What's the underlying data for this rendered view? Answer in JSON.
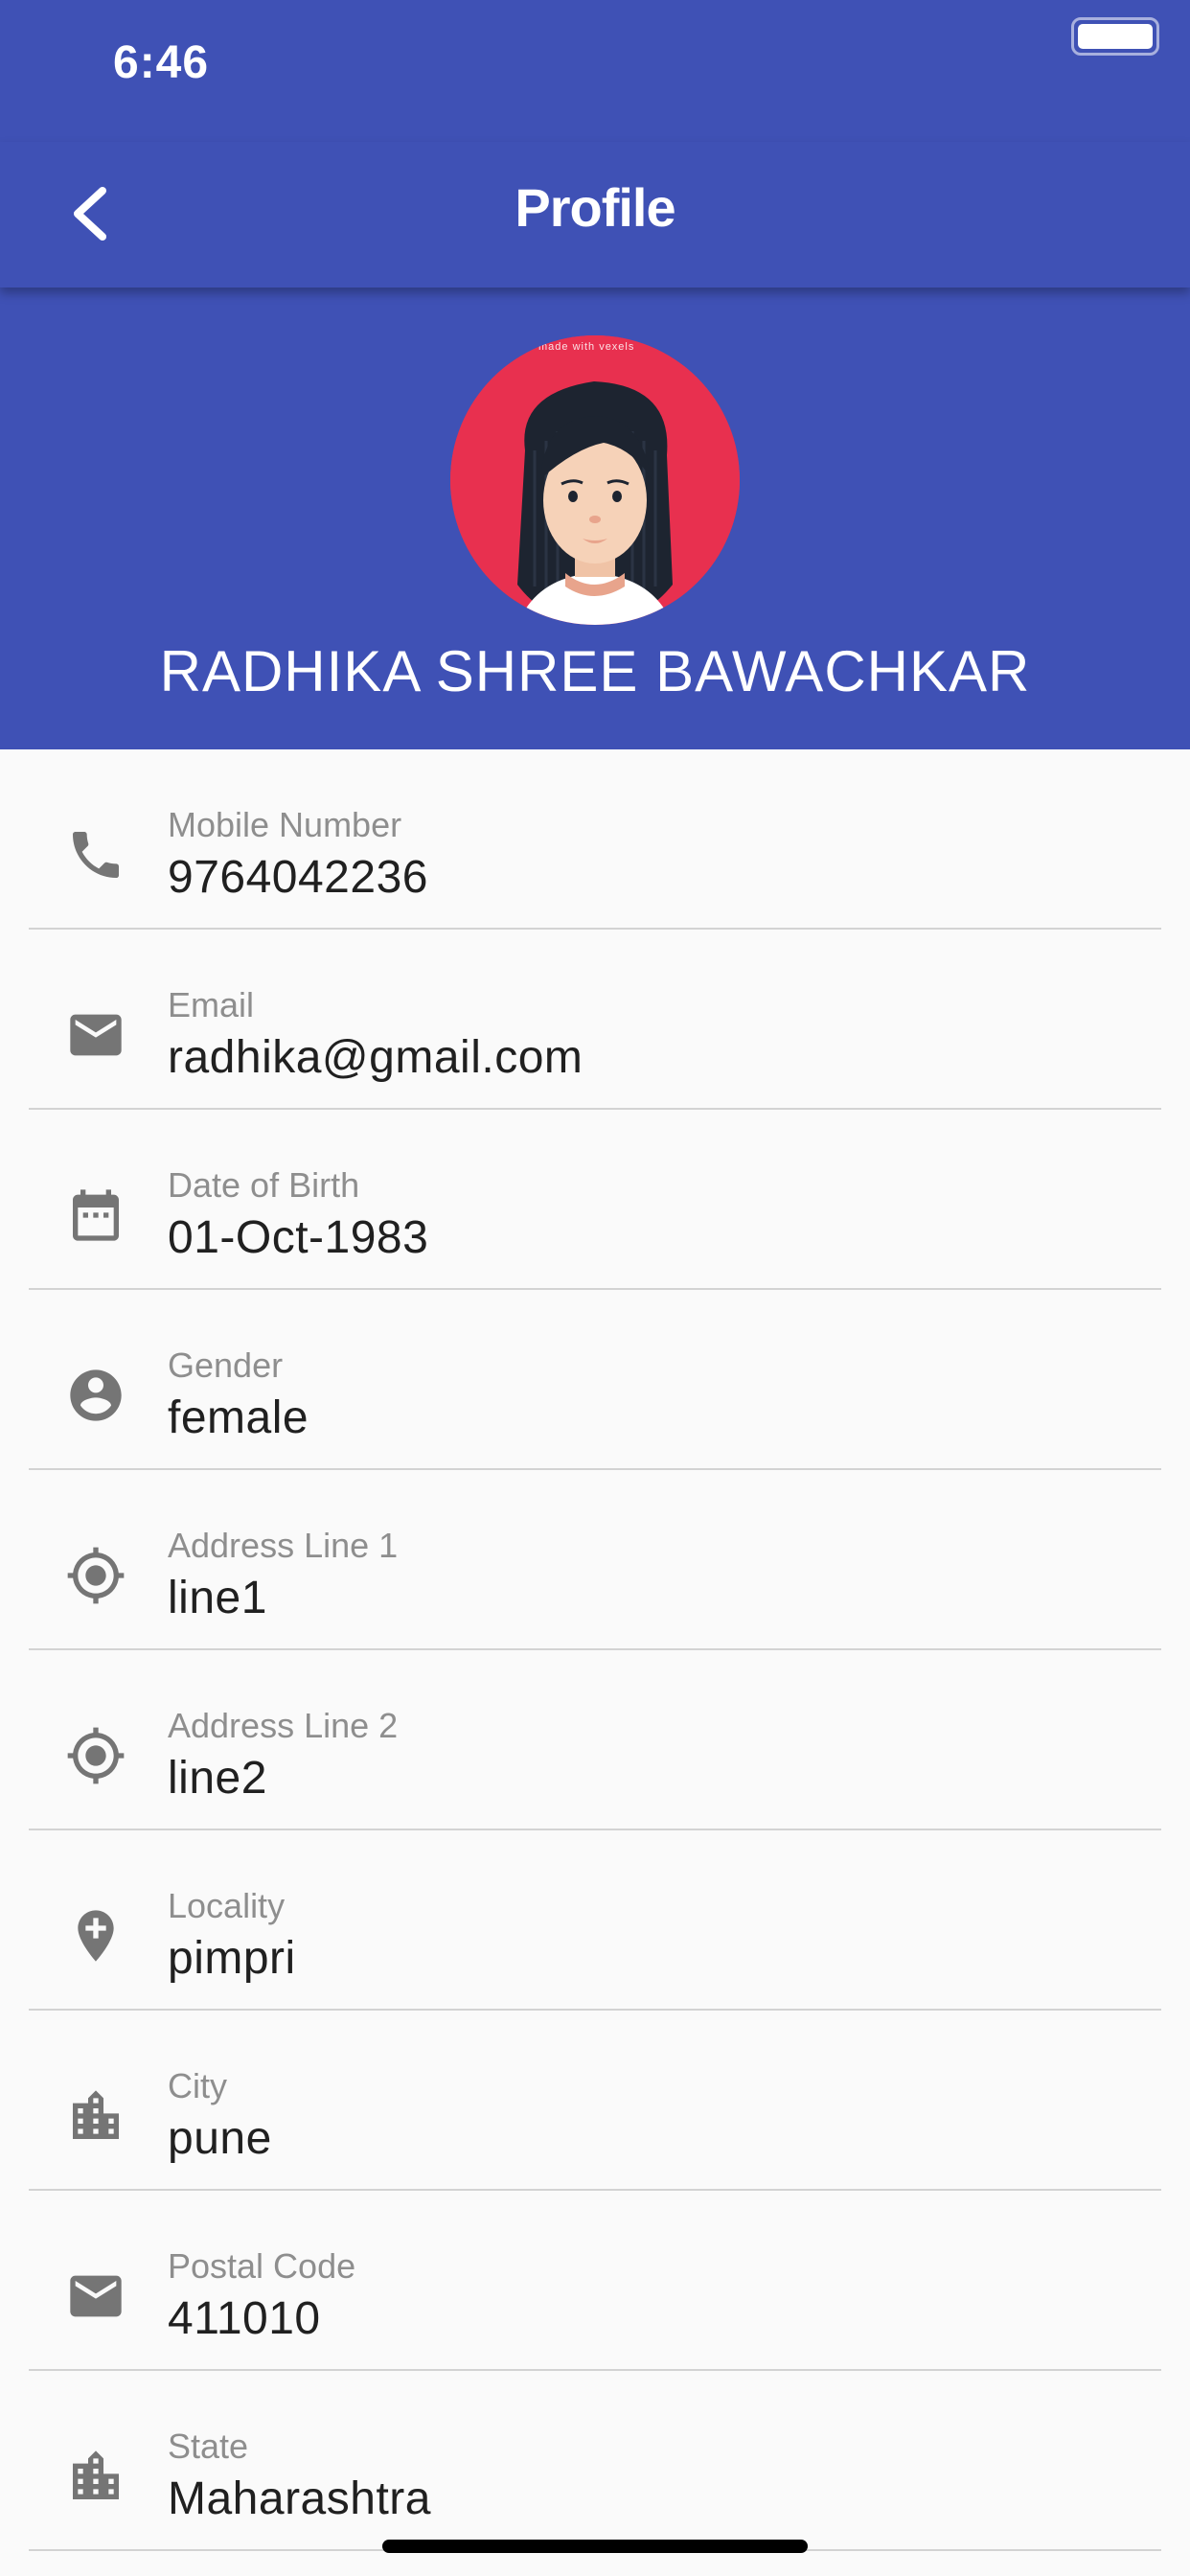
{
  "status_bar": {
    "time": "6:46"
  },
  "app_bar": {
    "title": "Profile",
    "back_icon": "chevron-left-icon"
  },
  "header": {
    "name": "RADHIKA SHREE BAWACHKAR",
    "avatar_watermark": "made with vexels",
    "background_color": "#3f51b5",
    "avatar_background": "#e8304f"
  },
  "fields": [
    {
      "icon": "phone-icon",
      "label": "Mobile Number",
      "value": "9764042236"
    },
    {
      "icon": "mail-icon",
      "label": "Email",
      "value": "radhika@gmail.com"
    },
    {
      "icon": "calendar-icon",
      "label": "Date of Birth",
      "value": "01-Oct-1983"
    },
    {
      "icon": "account-circle-icon",
      "label": "Gender",
      "value": "female"
    },
    {
      "icon": "gps-target-icon",
      "label": "Address Line 1",
      "value": "line1"
    },
    {
      "icon": "gps-target-icon",
      "label": "Address Line 2",
      "value": "line2"
    },
    {
      "icon": "add-location-icon",
      "label": "Locality",
      "value": "pimpri"
    },
    {
      "icon": "city-icon",
      "label": "City",
      "value": "pune"
    },
    {
      "icon": "mail-icon",
      "label": "Postal Code",
      "value": "411010"
    },
    {
      "icon": "city-icon",
      "label": "State",
      "value": "Maharashtra"
    }
  ]
}
